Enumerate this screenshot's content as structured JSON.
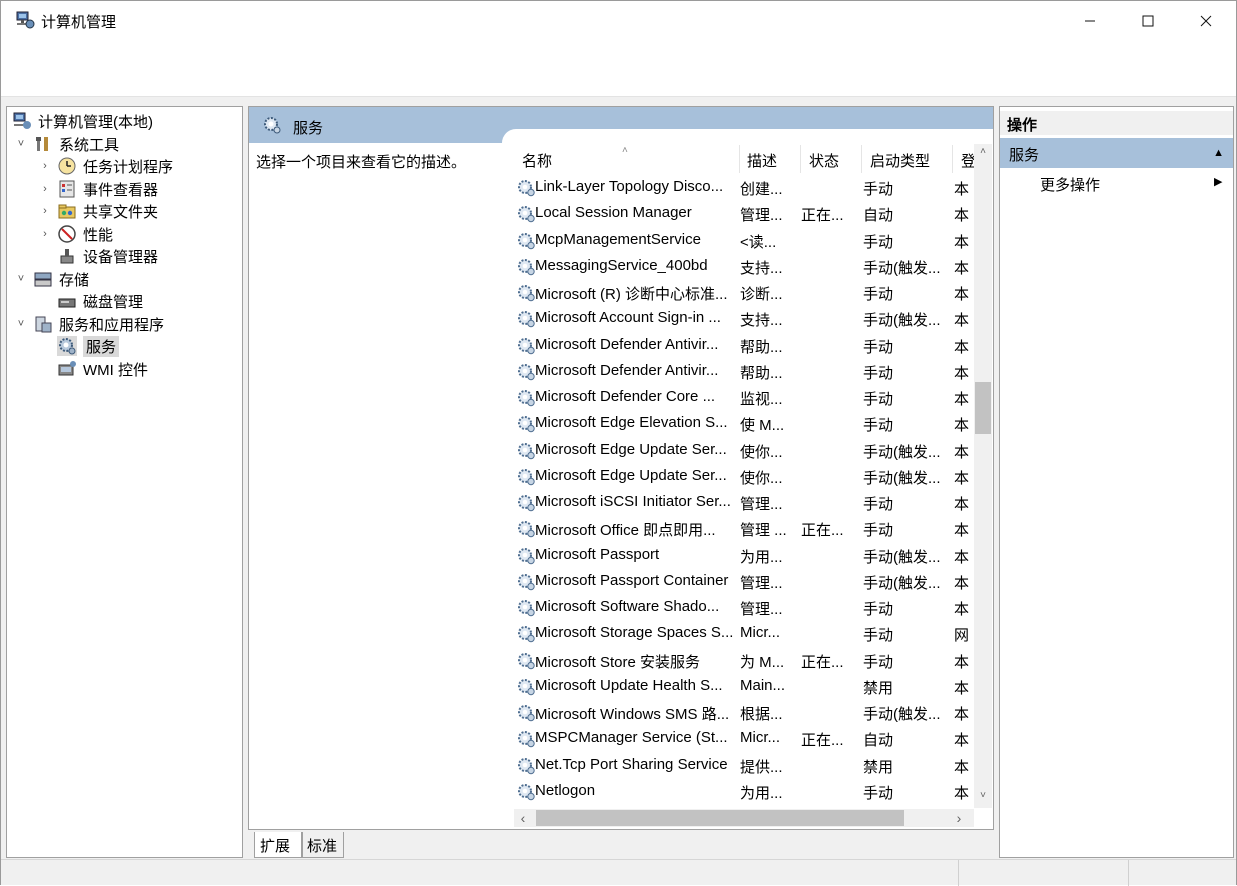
{
  "window": {
    "title": "计算机管理",
    "min_glyph": "—",
    "max_glyph": "☐",
    "close_glyph": "✕"
  },
  "tree": {
    "root": "计算机管理(本地)",
    "items": [
      {
        "label": "系统工具",
        "expander": "˅",
        "icon": "tools-icon"
      },
      {
        "label": "任务计划程序",
        "expander": "›",
        "icon": "clock-icon"
      },
      {
        "label": "事件查看器",
        "expander": "›",
        "icon": "event-viewer-icon"
      },
      {
        "label": "共享文件夹",
        "expander": "›",
        "icon": "shared-folder-icon"
      },
      {
        "label": "性能",
        "expander": "›",
        "icon": "performance-icon"
      },
      {
        "label": "设备管理器",
        "expander": "",
        "icon": "device-manager-icon"
      },
      {
        "label": "存储",
        "expander": "˅",
        "icon": "storage-icon"
      },
      {
        "label": "磁盘管理",
        "expander": "",
        "icon": "disk-icon"
      },
      {
        "label": "服务和应用程序",
        "expander": "˅",
        "icon": "services-apps-icon"
      },
      {
        "label": "服务",
        "expander": "",
        "icon": "services-gear-icon"
      },
      {
        "label": "WMI 控件",
        "expander": "",
        "icon": "wmi-icon"
      }
    ]
  },
  "center": {
    "header_title": "服务",
    "description_hint": "选择一个项目来查看它的描述。",
    "columns": {
      "name": "名称",
      "desc": "描述",
      "status": "状态",
      "startup": "启动类型",
      "logon": "登"
    },
    "sort_caret": "˄",
    "rows": [
      {
        "name": "Link-Layer Topology Disco...",
        "desc": "创建...",
        "status": "",
        "startup": "手动",
        "logon": "本"
      },
      {
        "name": "Local Session Manager",
        "desc": "管理...",
        "status": "正在...",
        "startup": "自动",
        "logon": "本"
      },
      {
        "name": "McpManagementService",
        "desc": "<读...",
        "status": "",
        "startup": "手动",
        "logon": "本"
      },
      {
        "name": "MessagingService_400bd",
        "desc": "支持...",
        "status": "",
        "startup": "手动(触发...",
        "logon": "本"
      },
      {
        "name": "Microsoft (R) 诊断中心标准...",
        "desc": "诊断...",
        "status": "",
        "startup": "手动",
        "logon": "本"
      },
      {
        "name": "Microsoft Account Sign-in ...",
        "desc": "支持...",
        "status": "",
        "startup": "手动(触发...",
        "logon": "本"
      },
      {
        "name": "Microsoft Defender Antivir...",
        "desc": "帮助...",
        "status": "",
        "startup": "手动",
        "logon": "本"
      },
      {
        "name": "Microsoft Defender Antivir...",
        "desc": "帮助...",
        "status": "",
        "startup": "手动",
        "logon": "本"
      },
      {
        "name": "Microsoft Defender Core ...",
        "desc": "监视...",
        "status": "",
        "startup": "手动",
        "logon": "本"
      },
      {
        "name": "Microsoft Edge Elevation S...",
        "desc": "使 M...",
        "status": "",
        "startup": "手动",
        "logon": "本"
      },
      {
        "name": "Microsoft Edge Update Ser...",
        "desc": "使你...",
        "status": "",
        "startup": "手动(触发...",
        "logon": "本"
      },
      {
        "name": "Microsoft Edge Update Ser...",
        "desc": "使你...",
        "status": "",
        "startup": "手动(触发...",
        "logon": "本"
      },
      {
        "name": "Microsoft iSCSI Initiator Ser...",
        "desc": "管理...",
        "status": "",
        "startup": "手动",
        "logon": "本"
      },
      {
        "name": "Microsoft Office 即点即用...",
        "desc": "管理 ...",
        "status": "正在...",
        "startup": "手动",
        "logon": "本"
      },
      {
        "name": "Microsoft Passport",
        "desc": "为用...",
        "status": "",
        "startup": "手动(触发...",
        "logon": "本"
      },
      {
        "name": "Microsoft Passport Container",
        "desc": "管理...",
        "status": "",
        "startup": "手动(触发...",
        "logon": "本"
      },
      {
        "name": "Microsoft Software Shado...",
        "desc": "管理...",
        "status": "",
        "startup": "手动",
        "logon": "本"
      },
      {
        "name": "Microsoft Storage Spaces S...",
        "desc": "Micr...",
        "status": "",
        "startup": "手动",
        "logon": "网"
      },
      {
        "name": "Microsoft Store 安装服务",
        "desc": "为 M...",
        "status": "正在...",
        "startup": "手动",
        "logon": "本"
      },
      {
        "name": "Microsoft Update Health S...",
        "desc": "Main...",
        "status": "",
        "startup": "禁用",
        "logon": "本"
      },
      {
        "name": "Microsoft Windows SMS 路...",
        "desc": "根据...",
        "status": "",
        "startup": "手动(触发...",
        "logon": "本"
      },
      {
        "name": "MSPCManager Service (St...",
        "desc": "Micr...",
        "status": "正在...",
        "startup": "自动",
        "logon": "本"
      },
      {
        "name": "Net.Tcp Port Sharing Service",
        "desc": "提供...",
        "status": "",
        "startup": "禁用",
        "logon": "本"
      },
      {
        "name": "Netlogon",
        "desc": "为用...",
        "status": "",
        "startup": "手动",
        "logon": "本"
      }
    ]
  },
  "scroll": {
    "up": "˄",
    "down": "˅",
    "left": "‹",
    "right": "›"
  },
  "tabs": {
    "extended": "扩展",
    "standard": "标准"
  },
  "actions": {
    "title": "操作",
    "section": "服务",
    "section_arrow": "▲",
    "more": "更多操作",
    "more_arrow": "▶"
  },
  "colors": {
    "header_blue": "#a7c0da",
    "selected_gray": "#d9d9d9"
  }
}
